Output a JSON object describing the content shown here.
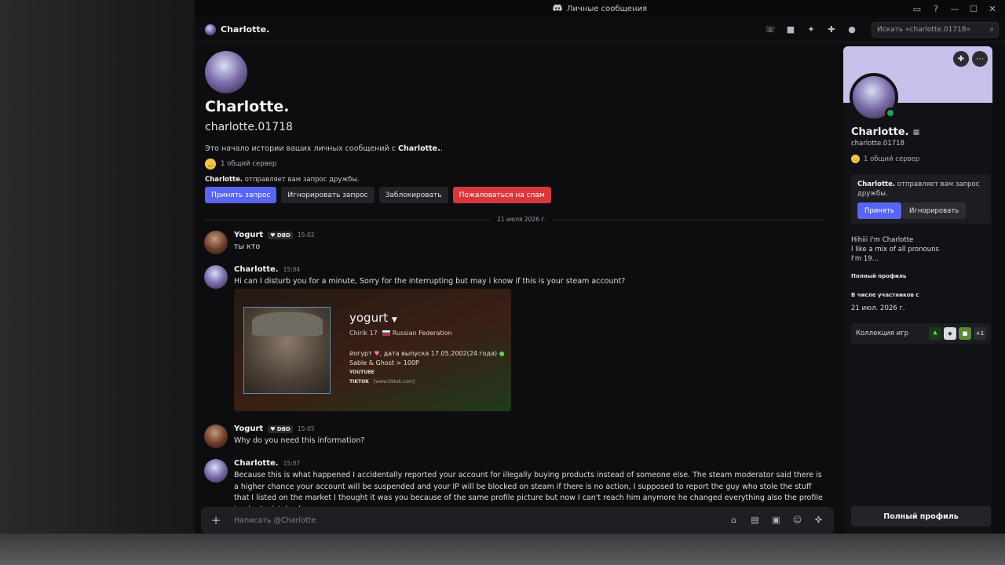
{
  "window": {
    "title": "Личные сообщения"
  },
  "header": {
    "name": "Charlotte.",
    "search_placeholder": "Искать «charlotte.01718»"
  },
  "intro": {
    "display_name": "Charlotte.",
    "username": "charlotte.01718",
    "description_prefix": "Это начало истории ваших личных сообщений с ",
    "description_name": "Charlotte.",
    "description_suffix": ".",
    "mutual": "1 общий сервер",
    "request_name": "Charlotte.",
    "request_text": " отправляет вам запрос дружбы.",
    "buttons": {
      "accept": "Принять запрос",
      "ignore": "Игнорировать запрос",
      "block": "Заблокировать",
      "spam": "Пожаловаться на спам"
    }
  },
  "divider_date": "21 июля 2026 г.",
  "messages": [
    {
      "author": "Yogurt",
      "badge": "DBD",
      "time": "15:02",
      "text": "ты кто"
    },
    {
      "author": "Charlotte.",
      "time": "15:04",
      "text": "Hi can I disturb you for a minute, Sorry for the interrupting but may i know if this is your steam account?"
    },
    {
      "author": "Yogurt",
      "badge": "DBD",
      "time": "15:05",
      "text": "Why do you need this information?"
    },
    {
      "author": "Charlotte.",
      "time": "15:07",
      "text": "Because this is what happened I accidentally reported your account for illegally buying products instead of someone else. The steam moderator said there is a higher chance your account will be suspended and your IP will be blocked on steam if there is no action, I supposed to report the guy who stole the stuff that I listed on the market I thought it was you because of the same profile picture but now I can't reach him anymore he changed everything also the profile is why I mistakenly"
    }
  ],
  "embed": {
    "username": "yogurt",
    "location_prefix": "Chirik 17",
    "country": "Russian Federation",
    "bio_line1": "йогурт",
    "bio_line1_rest": ", дата выпуска 17.05.2002(24 года)",
    "bio_line2": "Sable & Ghost > 100P",
    "youtube": "YOUTUBE",
    "tiktok": "TIKTOK",
    "tiktok_link": "[www.tiktok.com]"
  },
  "composer": {
    "placeholder": "Написать @Charlotte."
  },
  "profile": {
    "display_name": "Charlotte.",
    "username": "charlotte.01718",
    "mutual": "1 общий сервер",
    "request_name": "Charlotte.",
    "request_text": " отправляет вам запрос дружбы.",
    "accept": "Принять",
    "ignore": "Игнорировать",
    "bio": [
      "Hihiii I'm Charlotte",
      "I like a mix of all pronouns",
      "I'm 19..."
    ],
    "full_profile_label": "Полный профиль",
    "member_since_label": "В числе участников с",
    "member_since": "21 июл. 2026 г.",
    "games_label": "Коллекция игр",
    "games_more": "+1",
    "full_profile_button": "Полный профиль"
  },
  "colors": {
    "accent": "#5865f2",
    "danger": "#da373c",
    "online": "#23a55a",
    "banner": "#c8c0ea"
  }
}
